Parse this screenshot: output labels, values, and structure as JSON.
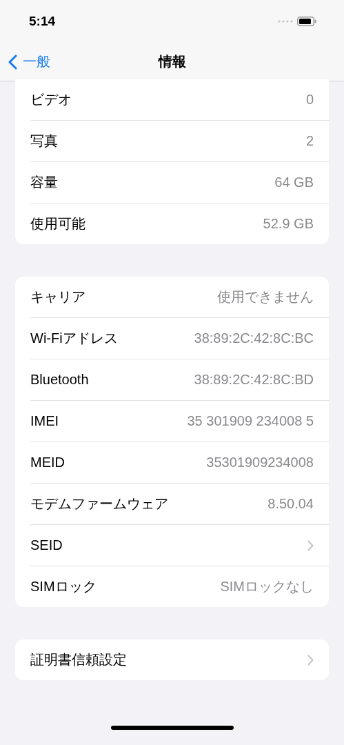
{
  "status_bar": {
    "time": "5:14"
  },
  "nav": {
    "back": "一般",
    "title": "情報"
  },
  "groups": [
    {
      "rows": [
        {
          "kind": "value",
          "label": "ビデオ",
          "value": "0"
        },
        {
          "kind": "value",
          "label": "写真",
          "value": "2"
        },
        {
          "kind": "value",
          "label": "容量",
          "value": "64 GB"
        },
        {
          "kind": "value",
          "label": "使用可能",
          "value": "52.9 GB"
        }
      ]
    },
    {
      "rows": [
        {
          "kind": "value",
          "label": "キャリア",
          "value": "使用できません"
        },
        {
          "kind": "value",
          "label": "Wi-Fiアドレス",
          "value": "38:89:2C:42:8C:BC"
        },
        {
          "kind": "value",
          "label": "Bluetooth",
          "value": "38:89:2C:42:8C:BD"
        },
        {
          "kind": "value",
          "label": "IMEI",
          "value": "35 301909 234008 5"
        },
        {
          "kind": "value",
          "label": "MEID",
          "value": "35301909234008"
        },
        {
          "kind": "value",
          "label": "モデムファームウェア",
          "value": "8.50.04"
        },
        {
          "kind": "disclosure",
          "label": "SEID"
        },
        {
          "kind": "value",
          "label": "SIMロック",
          "value": "SIMロックなし"
        }
      ]
    },
    {
      "rows": [
        {
          "kind": "disclosure",
          "label": "証明書信頼設定"
        }
      ]
    }
  ]
}
